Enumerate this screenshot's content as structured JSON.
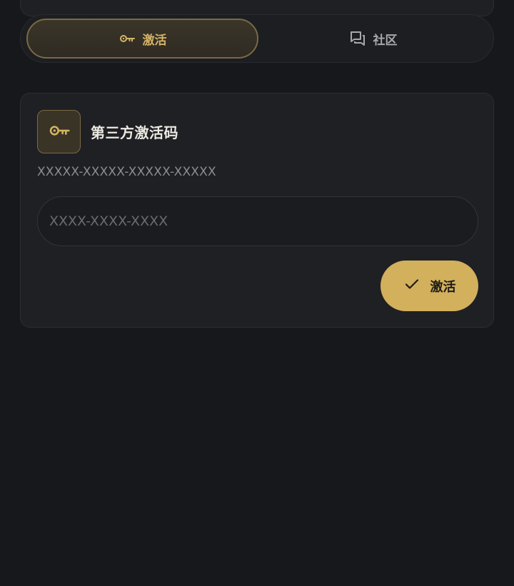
{
  "tabs": [
    {
      "label": "激活",
      "icon": "key-icon",
      "active": true
    },
    {
      "label": "社区",
      "icon": "chat-icon",
      "active": false
    }
  ],
  "card": {
    "icon": "key-icon",
    "title": "第三方激活码",
    "hint": "XXXXX-XXXXX-XXXXX-XXXXX",
    "input": {
      "value": "",
      "placeholder": "XXXX-XXXX-XXXX"
    },
    "button": {
      "icon": "check-icon",
      "label": "激活"
    }
  },
  "colors": {
    "background": "#17181b",
    "card": "#1f2023",
    "accent": "#d2b05c",
    "accent_text": "#d5b465",
    "muted_text": "#8d8d92"
  }
}
